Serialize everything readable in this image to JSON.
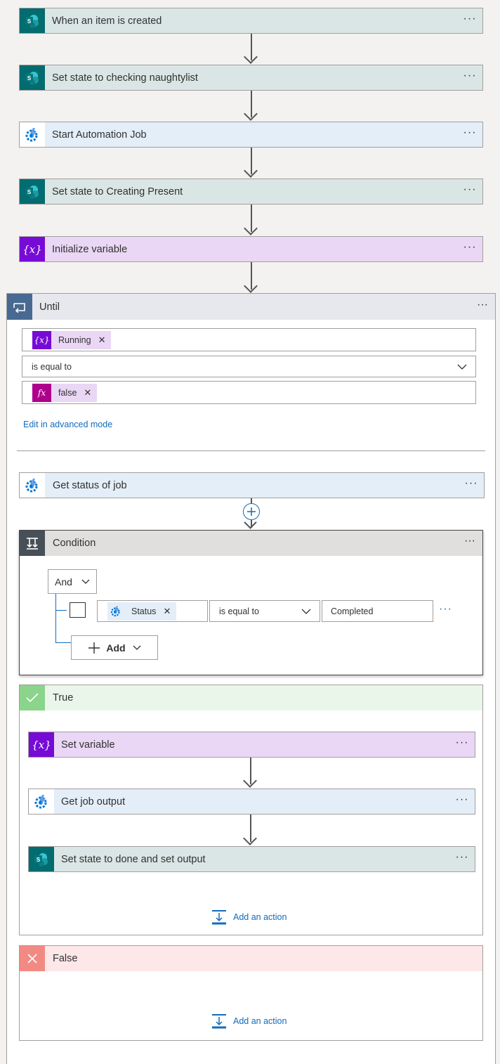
{
  "steps": [
    {
      "title": "When an item is created"
    },
    {
      "title": "Set state to checking naughtylist"
    },
    {
      "title": "Start Automation Job"
    },
    {
      "title": "Set state to Creating Present"
    },
    {
      "title": "Initialize variable"
    }
  ],
  "more_label": "···",
  "until": {
    "title": "Until",
    "left_token": "Running",
    "operator": "is equal to",
    "right_token": "false",
    "advanced_link": "Edit in advanced mode",
    "get_status": "Get status of job"
  },
  "condition": {
    "title": "Condition",
    "group_operator": "And",
    "left_token": "Status",
    "operator": "is equal to",
    "value": "Completed",
    "add_label": "Add"
  },
  "true_branch": {
    "title": "True",
    "steps": [
      {
        "title": "Set variable"
      },
      {
        "title": "Get job output"
      },
      {
        "title": "Set state to done and set output"
      }
    ],
    "add_action": "Add an action"
  },
  "false_branch": {
    "title": "False",
    "add_action": "Add an action"
  },
  "colors": {
    "sharepoint": "#036c70",
    "automation": "#0078d4",
    "variable": "#770bd6",
    "expression": "#ad008c",
    "until": "#486991",
    "true": "#8bd48b",
    "false": "#f28a83",
    "link": "#0f6cbd"
  }
}
